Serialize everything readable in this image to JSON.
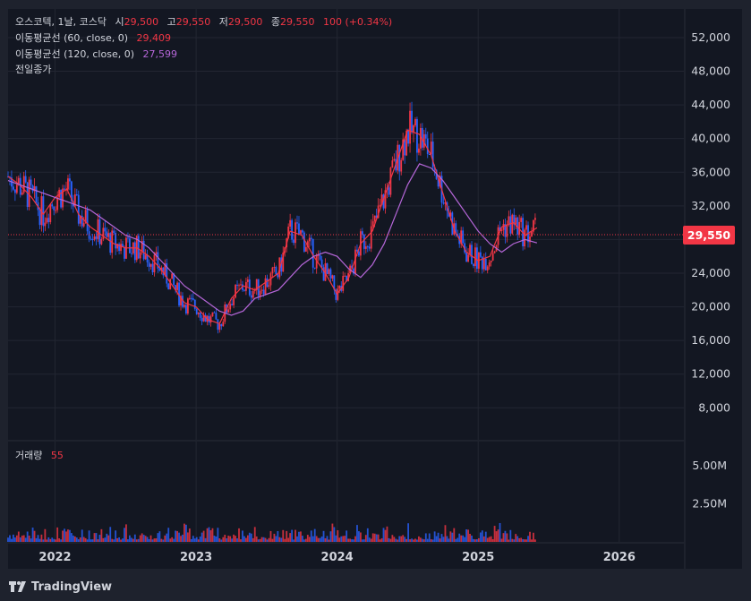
{
  "header": {
    "symbol": "오스코텍, 1날, 코스닥",
    "open_label": "시",
    "open_value": "29,500",
    "high_label": "고",
    "high_value": "29,550",
    "low_label": "저",
    "low_value": "29,500",
    "close_label": "종",
    "close_value": "29,550",
    "change": "100 (+0.34%)"
  },
  "indicators": [
    {
      "label": "이동평균선 (60, close, 0)",
      "value": "29,409",
      "color": "#f23645"
    },
    {
      "label": "이동평균선 (120, close, 0)",
      "value": "27,599",
      "color": "#b566d8"
    },
    {
      "label": "전일종가",
      "value": ""
    }
  ],
  "volume_label": "거래량",
  "volume_value": "55",
  "last_price_label": "29,550",
  "brand": "TradingView",
  "colors": {
    "up": "#f23645",
    "down": "#2962ff",
    "ma60": "#f23645",
    "ma120": "#b566d8",
    "background": "#1e222d",
    "panel": "#131722"
  },
  "chart_data": {
    "type": "line",
    "price_axis_ticks": [
      "52,000",
      "48,000",
      "44,000",
      "40,000",
      "36,000",
      "32,000",
      "28,000",
      "24,000",
      "20,000",
      "16,000",
      "12,000",
      "8,000"
    ],
    "price_ylim": [
      4200,
      55400
    ],
    "volume_axis_ticks": [
      "5.00M",
      "2.50M"
    ],
    "volume_ylim": [
      0,
      6600000
    ],
    "time_axis_ticks": [
      "2022",
      "2023",
      "2024",
      "2025",
      "2026"
    ],
    "x_dates": [
      "2021-09",
      "2021-10",
      "2021-11",
      "2021-12",
      "2022-01",
      "2022-02",
      "2022-03",
      "2022-04",
      "2022-05",
      "2022-06",
      "2022-07",
      "2022-08",
      "2022-09",
      "2022-10",
      "2022-11",
      "2022-12",
      "2023-01",
      "2023-02",
      "2023-03",
      "2023-04",
      "2023-05",
      "2023-06",
      "2023-07",
      "2023-08",
      "2023-09",
      "2023-10",
      "2023-11",
      "2023-12",
      "2024-01",
      "2024-02",
      "2024-03",
      "2024-04",
      "2024-05",
      "2024-06",
      "2024-07",
      "2024-08",
      "2024-09",
      "2024-10",
      "2024-11",
      "2024-12",
      "2025-01",
      "2025-02",
      "2025-03",
      "2025-04",
      "2025-05",
      "2025-06"
    ],
    "series": [
      {
        "name": "이동평균선 (60, close, 0)",
        "values": [
          35500,
          34500,
          33000,
          31000,
          33000,
          34000,
          31000,
          29500,
          28500,
          27500,
          27000,
          27000,
          26000,
          24500,
          22500,
          20500,
          20000,
          18500,
          18000,
          21000,
          22500,
          22000,
          23000,
          24000,
          29000,
          28500,
          26000,
          24000,
          21500,
          23500,
          27500,
          29000,
          33000,
          37000,
          41000,
          40500,
          38000,
          33500,
          29000,
          26500,
          25500,
          26000,
          29500,
          30000,
          28500,
          29400
        ]
      },
      {
        "name": "이동평균선 (120, close, 0)",
        "values": [
          35000,
          34500,
          34000,
          33500,
          33000,
          32500,
          32000,
          31500,
          30500,
          29500,
          28500,
          28000,
          27000,
          25500,
          24000,
          22500,
          21500,
          20500,
          19500,
          19000,
          19500,
          21000,
          21500,
          22000,
          23500,
          25000,
          26000,
          26500,
          26000,
          24500,
          23500,
          25000,
          27500,
          31000,
          34500,
          37000,
          36500,
          35000,
          33000,
          31000,
          29000,
          27500,
          26500,
          27500,
          28000,
          27600
        ]
      }
    ],
    "grid": true,
    "legend": "top-left"
  }
}
